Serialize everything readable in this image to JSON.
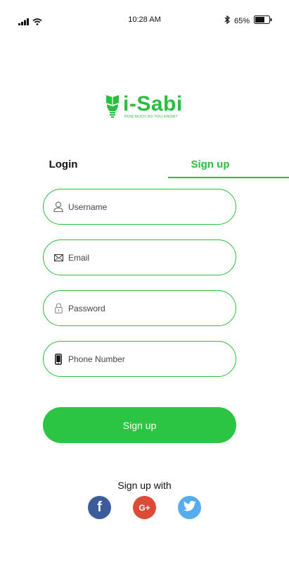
{
  "status_bar": {
    "time": "10:28 AM",
    "battery": "65%",
    "battery_level": 0.65
  },
  "logo": {
    "title": "i-Sabi",
    "tagline": "HOW MUCH DO YOU KNOW?",
    "icon": "bulb-book-icon"
  },
  "tabs": {
    "login": "Login",
    "signup": "Sign up",
    "active": "signup"
  },
  "form": {
    "username": {
      "placeholder": "Username",
      "icon": "user-icon"
    },
    "email": {
      "placeholder": "Email",
      "icon": "envelope-icon"
    },
    "password": {
      "placeholder": "Password",
      "icon": "lock-icon"
    },
    "phone": {
      "placeholder": "Phone Number",
      "icon": "phone-icon"
    },
    "submit_label": "Sign up"
  },
  "social": {
    "heading": "Sign up with",
    "facebook_glyph": "f",
    "google_glyph": "G+",
    "colors": {
      "facebook": "#3b5b9a",
      "google": "#dc4a38",
      "twitter": "#55acee"
    }
  },
  "colors": {
    "accent": "#2bbd3f",
    "button": "#2bc443"
  }
}
